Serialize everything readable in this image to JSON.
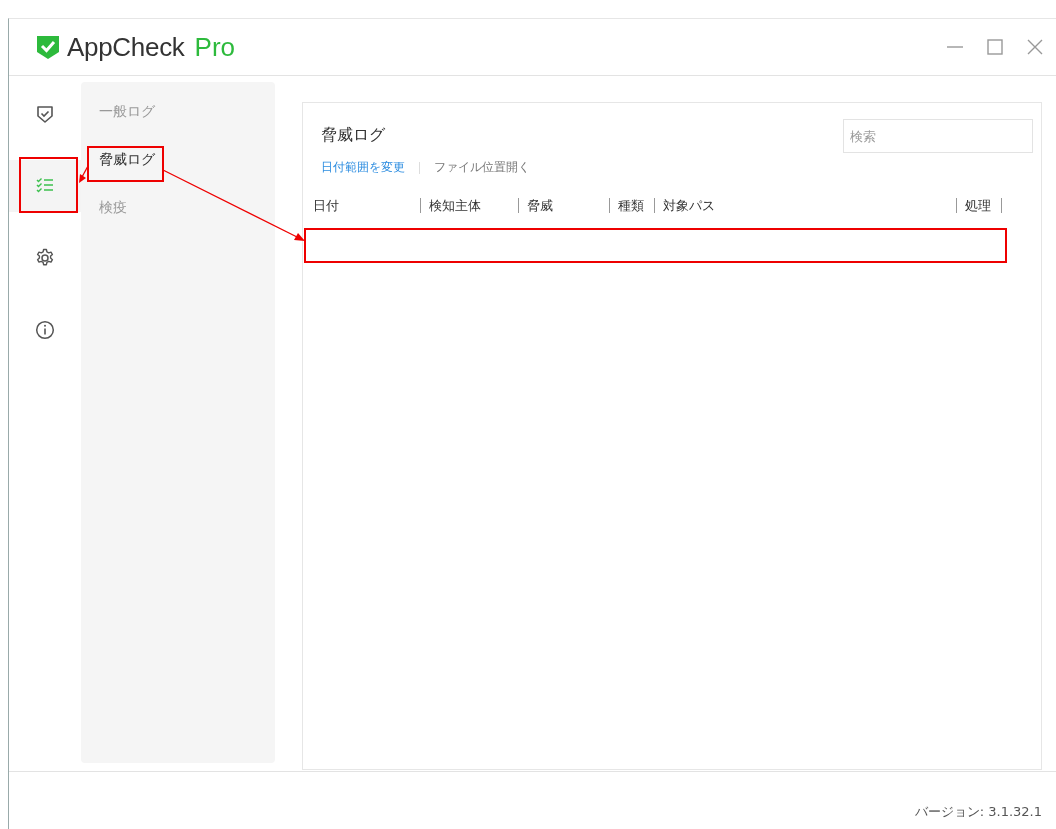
{
  "window": {
    "brand": "AppCheck",
    "edition": "Pro"
  },
  "rail": [
    {
      "kind": "shield",
      "selected": false
    },
    {
      "kind": "checklist",
      "selected": true
    },
    {
      "kind": "gear",
      "selected": false
    },
    {
      "kind": "info",
      "selected": false
    }
  ],
  "submenu": [
    {
      "label": "一般ログ",
      "selected": false
    },
    {
      "label": "脅威ログ",
      "selected": true
    },
    {
      "label": "検疫",
      "selected": false
    }
  ],
  "panel": {
    "title": "脅威ログ",
    "search": {
      "placeholder": "検索"
    },
    "actions": [
      {
        "label": "日付範囲を変更",
        "disabled": false
      },
      {
        "label": "ファイル位置開く",
        "disabled": true
      }
    ],
    "table": {
      "columns": [
        "日付",
        "検知主体",
        "脅威",
        "種類",
        "対象パス",
        "処理"
      ]
    }
  },
  "status_bar": {
    "version": "バージョン: 3.1.32.1"
  }
}
